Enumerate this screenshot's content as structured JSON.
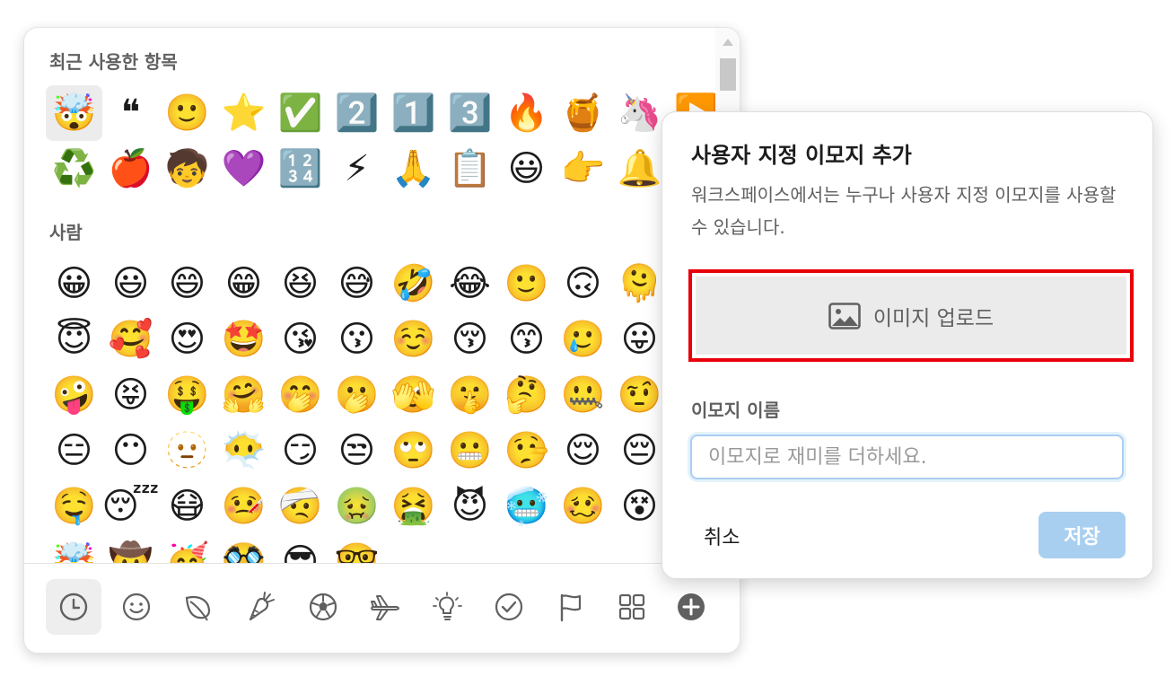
{
  "picker": {
    "recent_title": "최근 사용한 항목",
    "people_title": "사람",
    "recent": [
      {
        "char": "🤯",
        "name": "exploding-head",
        "selected": true
      },
      {
        "char": "❝",
        "name": "quote"
      },
      {
        "char": "🙂",
        "name": "slight-smile"
      },
      {
        "char": "⭐",
        "name": "star"
      },
      {
        "char": "✅",
        "name": "white-check-mark"
      },
      {
        "char": "2️⃣",
        "name": "two"
      },
      {
        "char": "1️⃣",
        "name": "one"
      },
      {
        "char": "3️⃣",
        "name": "three"
      },
      {
        "char": "🔥",
        "name": "fire"
      },
      {
        "char": "🍯",
        "name": "honey-pot"
      },
      {
        "char": "🦄",
        "name": "unicorn"
      },
      {
        "char": "▶️",
        "name": "arrow-forward"
      },
      {
        "char": "♻️",
        "name": "recycle"
      },
      {
        "char": "🍎",
        "name": "apple"
      },
      {
        "char": "🧒",
        "name": "child"
      },
      {
        "char": "💜",
        "name": "purple-heart"
      },
      {
        "char": "🔢",
        "name": "1234"
      },
      {
        "char": "⚡",
        "name": "zap"
      },
      {
        "char": "🙏",
        "name": "pray"
      },
      {
        "char": "📋",
        "name": "clipboard"
      },
      {
        "char": "😃",
        "name": "smiley"
      },
      {
        "char": "👉",
        "name": "point-right"
      },
      {
        "char": "🔔",
        "name": "bell"
      }
    ],
    "people": [
      {
        "char": "😀",
        "name": "grinning"
      },
      {
        "char": "😃",
        "name": "smiley"
      },
      {
        "char": "😄",
        "name": "smile"
      },
      {
        "char": "😁",
        "name": "grin"
      },
      {
        "char": "😆",
        "name": "laughing"
      },
      {
        "char": "😅",
        "name": "sweat-smile"
      },
      {
        "char": "🤣",
        "name": "rofl"
      },
      {
        "char": "😂",
        "name": "joy"
      },
      {
        "char": "🙂",
        "name": "slight-smile"
      },
      {
        "char": "🙃",
        "name": "upside-down"
      },
      {
        "char": "🫠",
        "name": "melting-face"
      },
      {
        "char": "😊",
        "name": "blush"
      },
      {
        "char": "😇",
        "name": "innocent"
      },
      {
        "char": "🥰",
        "name": "smiling-hearts"
      },
      {
        "char": "😍",
        "name": "heart-eyes"
      },
      {
        "char": "🤩",
        "name": "star-struck"
      },
      {
        "char": "😘",
        "name": "kissing-heart"
      },
      {
        "char": "😗",
        "name": "kissing"
      },
      {
        "char": "☺️",
        "name": "relaxed"
      },
      {
        "char": "😚",
        "name": "kissing-closed-eyes"
      },
      {
        "char": "😙",
        "name": "kissing-smiling-eyes"
      },
      {
        "char": "🥲",
        "name": "smiling-tear"
      },
      {
        "char": "😛",
        "name": "tongue"
      },
      {
        "char": "😜",
        "name": "wink-tongue"
      },
      {
        "char": "🤪",
        "name": "zany-face"
      },
      {
        "char": "😝",
        "name": "squint-tongue"
      },
      {
        "char": "🤑",
        "name": "money-mouth"
      },
      {
        "char": "🤗",
        "name": "hugging"
      },
      {
        "char": "🤭",
        "name": "hand-over-mouth"
      },
      {
        "char": "🫢",
        "name": "open-eyes-hand-mouth"
      },
      {
        "char": "🫣",
        "name": "peeking-eye"
      },
      {
        "char": "🤫",
        "name": "shushing"
      },
      {
        "char": "🤔",
        "name": "thinking"
      },
      {
        "char": "🤐",
        "name": "zipper-mouth"
      },
      {
        "char": "🤨",
        "name": "raised-eyebrow"
      },
      {
        "char": "😐",
        "name": "neutral"
      },
      {
        "char": "😑",
        "name": "expressionless"
      },
      {
        "char": "😶",
        "name": "no-mouth"
      },
      {
        "char": "🫥",
        "name": "dotted-line-face"
      },
      {
        "char": "😶‍🌫️",
        "name": "face-in-clouds"
      },
      {
        "char": "😏",
        "name": "smirk"
      },
      {
        "char": "😒",
        "name": "unamused"
      },
      {
        "char": "🙄",
        "name": "rolling-eyes"
      },
      {
        "char": "😬",
        "name": "grimacing"
      },
      {
        "char": "🤥",
        "name": "lying-face"
      },
      {
        "char": "😌",
        "name": "relieved"
      },
      {
        "char": "😔",
        "name": "pensive"
      },
      {
        "char": "😪",
        "name": "sleepy"
      },
      {
        "char": "🤤",
        "name": "drooling"
      },
      {
        "char": "😴",
        "name": "sleeping"
      },
      {
        "char": "😷",
        "name": "mask"
      },
      {
        "char": "🤒",
        "name": "thermometer-face"
      },
      {
        "char": "🤕",
        "name": "head-bandage"
      },
      {
        "char": "🤢",
        "name": "nauseated"
      },
      {
        "char": "🤮",
        "name": "vomiting"
      },
      {
        "char": "😈",
        "name": "smiling-imp"
      },
      {
        "char": "🥶",
        "name": "cold-face"
      },
      {
        "char": "🥴",
        "name": "woozy-face"
      },
      {
        "char": "😵",
        "name": "dizzy-face"
      },
      {
        "char": "😵‍💫",
        "name": "face-spiral-eyes"
      },
      {
        "char": "🤯",
        "name": "exploding-head"
      },
      {
        "char": "🤠",
        "name": "cowboy"
      },
      {
        "char": "🥳",
        "name": "partying-face"
      },
      {
        "char": "🥸",
        "name": "disguised-face"
      },
      {
        "char": "😎",
        "name": "sunglasses"
      },
      {
        "char": "🤓",
        "name": "nerd"
      }
    ]
  },
  "categories": [
    {
      "name": "recent",
      "active": true
    },
    {
      "name": "smileys"
    },
    {
      "name": "nature"
    },
    {
      "name": "food"
    },
    {
      "name": "activity"
    },
    {
      "name": "travel"
    },
    {
      "name": "objects"
    },
    {
      "name": "symbols"
    },
    {
      "name": "flags"
    },
    {
      "name": "custom-grid"
    },
    {
      "name": "add-custom"
    }
  ],
  "dialog": {
    "title": "사용자 지정 이모지 추가",
    "description": "워크스페이스에서는 누구나 사용자 지정 이모지를 사용할 수 있습니다.",
    "upload_label": "이미지 업로드",
    "name_label": "이모지 이름",
    "name_value": "",
    "name_placeholder": "이모지로 재미를 더하세요.",
    "cancel_label": "취소",
    "save_label": "저장",
    "highlight_color": "#e8000b",
    "save_color": "#a9cff0"
  }
}
